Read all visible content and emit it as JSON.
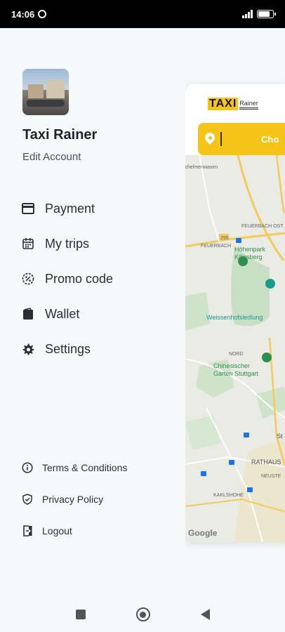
{
  "status_bar": {
    "time": "14:06",
    "battery_level": 0.8
  },
  "map_preview": {
    "logo_main": "TAXI",
    "logo_sub": "Rainer",
    "search_text": "Cho",
    "labels": {
      "district_1": "schelmenwasen",
      "district_2": "FEUERBACH OST",
      "street_1": "FEUERBACH",
      "road_num": "295",
      "park_1": "Höhenpark Killesberg",
      "place_1": "Weissenhofsiedlung",
      "district_3": "NORD",
      "park_2": "Chinesischer Garten Stuttgart",
      "city_part": "St",
      "district_4": "RATHAUS",
      "small_1": "NEUSTE",
      "small_2": "KAKLSHOHE"
    },
    "attribution": "Google"
  },
  "drawer": {
    "user_name": "Taxi Rainer",
    "edit_account": "Edit Account",
    "menu": [
      {
        "label": "Payment",
        "icon": "card-icon"
      },
      {
        "label": "My trips",
        "icon": "calendar-icon"
      },
      {
        "label": "Promo code",
        "icon": "promo-badge-icon"
      },
      {
        "label": "Wallet",
        "icon": "wallet-icon"
      },
      {
        "label": "Settings",
        "icon": "gear-icon"
      }
    ],
    "footer": [
      {
        "label": "Terms & Conditions",
        "icon": "info-icon"
      },
      {
        "label": "Privacy Policy",
        "icon": "shield-check-icon"
      },
      {
        "label": "Logout",
        "icon": "logout-icon"
      }
    ]
  },
  "colors": {
    "brand_yellow": "#f6c317",
    "text_dark": "#2b2f33"
  }
}
